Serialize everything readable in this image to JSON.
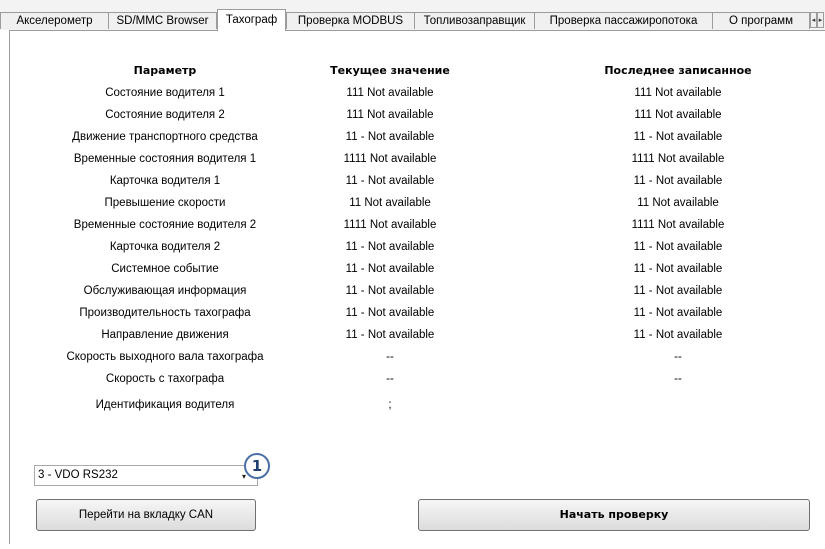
{
  "tabs": [
    {
      "label": "Акселерометр"
    },
    {
      "label": "SD/MMC Browser"
    },
    {
      "label": "Тахограф"
    },
    {
      "label": "Проверка MODBUS"
    },
    {
      "label": "Топливозаправщик"
    },
    {
      "label": "Проверка пассажиропотока"
    },
    {
      "label": "О программ"
    }
  ],
  "active_tab": "Тахограф",
  "scroll_buttons": {
    "left": "◂",
    "right": "▸"
  },
  "table": {
    "headers": [
      "Параметр",
      "Текущее значение",
      "Последнее записанное"
    ],
    "rows": [
      {
        "param": "Состояние водителя 1",
        "current": "111 Not available",
        "last": "111 Not available"
      },
      {
        "param": "Состояние водителя 2",
        "current": "111 Not available",
        "last": "111 Not available"
      },
      {
        "param": "Движение транспортного средства",
        "current": "11 - Not available",
        "last": "11 - Not available"
      },
      {
        "param": "Временные состояния водителя 1",
        "current": "1111 Not available",
        "last": "1111 Not available"
      },
      {
        "param": "Карточка водителя 1",
        "current": "11 - Not available",
        "last": "11 - Not available"
      },
      {
        "param": "Превышение скорости",
        "current": "11 Not available",
        "last": "11 Not available"
      },
      {
        "param": "Временные состояние водителя 2",
        "current": "1111 Not available",
        "last": "1111 Not available"
      },
      {
        "param": "Карточка водителя 2",
        "current": "11 - Not available",
        "last": "11 - Not available"
      },
      {
        "param": "Системное событие",
        "current": "11 - Not available",
        "last": "11 - Not available"
      },
      {
        "param": "Обслуживающая информация",
        "current": "11 - Not available",
        "last": "11 - Not available"
      },
      {
        "param": "Производительность тахографа",
        "current": "11 - Not available",
        "last": "11 - Not available"
      },
      {
        "param": "Направление движения",
        "current": "11 - Not available",
        "last": "11 - Not available"
      },
      {
        "param": "Скорость выходного вала тахографа",
        "current": "--",
        "last": "--"
      },
      {
        "param": "Скорость с тахографа",
        "current": "--",
        "last": "--"
      },
      {
        "param": "Идентификация водителя",
        "current": ";",
        "last": ""
      }
    ]
  },
  "combo": {
    "value": "3 - VDO RS232",
    "arrow": "▾"
  },
  "callout": {
    "label": "1"
  },
  "buttons": {
    "goto_can": "Перейти на вкладку CAN",
    "start_check": "Начать проверку"
  },
  "colors": {
    "callout_border": "#4a6fa5",
    "callout_text": "#1f3f73"
  }
}
